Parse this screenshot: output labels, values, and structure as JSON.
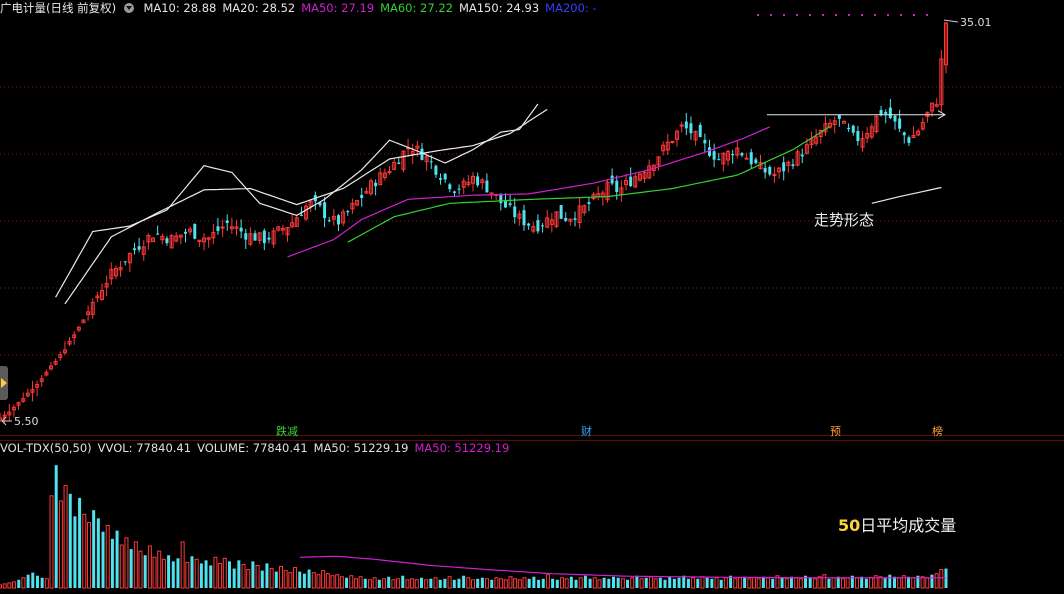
{
  "header": {
    "title": "广电计量(日线 前复权)",
    "indicators": [
      {
        "label": "MA10: 28.88",
        "color": "#e6e6e6"
      },
      {
        "label": "MA20: 28.52",
        "color": "#e6e6e6"
      },
      {
        "label": "MA50: 27.19",
        "color": "#d01fd0"
      },
      {
        "label": "MA60: 27.22",
        "color": "#35d035"
      },
      {
        "label": "MA150: 24.93",
        "color": "#e6e6e6"
      },
      {
        "label": "MA200: -",
        "color": "#3b3bff"
      }
    ]
  },
  "price_panel": {
    "high_label": "35.01",
    "low_label": "5.50",
    "annotation": "走势形态"
  },
  "event_tags": [
    {
      "label": "跌减",
      "color": "#3ad23a"
    },
    {
      "label": "财",
      "color": "#30a8ff"
    },
    {
      "label": "预",
      "color": "#ffa040"
    },
    {
      "label": "榜",
      "color": "#ffa040"
    }
  ],
  "volume_header": {
    "items": [
      {
        "label": "VOL-TDX(50,50)",
        "color": "#e0e0e0"
      },
      {
        "label": "VVOL: 77840.41",
        "color": "#e0e0e0"
      },
      {
        "label": "VOLUME: 77840.41",
        "color": "#e0e0e0"
      },
      {
        "label": "MA50: 51229.19",
        "color": "#e0e0e0"
      },
      {
        "label": "MA50: 51229.19",
        "color": "#d01fd0"
      }
    ]
  },
  "volume_annotation": {
    "number": "50",
    "text": "日平均成交量"
  },
  "colors": {
    "up": "#ff3838",
    "down": "#4fe3ef",
    "ma_short": "#eaeaea",
    "ma50": "#d01fd0",
    "ma60": "#35d035",
    "volume_ma": "#d01fd0"
  },
  "chart_data": {
    "type": "candlestick",
    "title": "广电计量(日线 前复权)",
    "y_label_high": 35.01,
    "y_label_low": 5.5,
    "close_path": [
      5.5,
      6.0,
      6.6,
      7.3,
      8.0,
      8.8,
      9.6,
      10.5,
      11.5,
      12.6,
      13.8,
      15.0,
      16.0,
      16.8,
      17.5,
      18.2,
      18.8,
      19.3,
      19.0,
      18.8,
      19.2,
      19.4,
      19.0,
      18.9,
      19.5,
      20.0,
      19.6,
      19.2,
      19.0,
      18.8,
      19.1,
      19.6,
      20.0,
      20.8,
      21.5,
      21.2,
      20.5,
      20.0,
      20.6,
      21.4,
      22.2,
      23.0,
      23.6,
      24.2,
      25.0,
      25.8,
      25.4,
      24.8,
      24.0,
      23.2,
      22.6,
      22.8,
      23.4,
      23.0,
      22.4,
      21.6,
      21.0,
      20.4,
      20.0,
      19.8,
      20.2,
      20.8,
      20.4,
      20.6,
      21.0,
      21.6,
      22.2,
      22.8,
      22.4,
      23.0,
      23.6,
      24.2,
      24.8,
      25.6,
      26.4,
      27.2,
      26.8,
      26.0,
      25.4,
      24.8,
      25.2,
      25.6,
      25.0,
      24.4,
      23.9,
      23.6,
      24.0,
      24.6,
      25.2,
      25.8,
      26.6,
      27.2,
      27.8,
      27.0,
      26.2,
      26.6,
      27.6,
      28.4,
      27.8,
      26.8,
      26.2,
      27.0,
      28.2,
      29.2,
      35.0
    ],
    "ma_series": [
      {
        "name": "MA10",
        "color": "#eaeaea",
        "start": 12,
        "anchors": [
          [
            0,
            14.5
          ],
          [
            8,
            19.4
          ],
          [
            16,
            19.8
          ],
          [
            24,
            21.0
          ],
          [
            32,
            24.3
          ],
          [
            38,
            23.8
          ],
          [
            44,
            21.5
          ],
          [
            52,
            20.6
          ],
          [
            58,
            21.8
          ],
          [
            66,
            24.0
          ],
          [
            72,
            26.2
          ],
          [
            78,
            25.4
          ],
          [
            84,
            24.5
          ],
          [
            90,
            25.5
          ],
          [
            96,
            26.8
          ],
          [
            100,
            27.0
          ],
          [
            104,
            28.9
          ]
        ]
      },
      {
        "name": "MA20",
        "color": "#eaeaea",
        "start": 14,
        "anchors": [
          [
            0,
            14.0
          ],
          [
            10,
            19.0
          ],
          [
            20,
            20.8
          ],
          [
            30,
            22.5
          ],
          [
            40,
            22.6
          ],
          [
            50,
            21.4
          ],
          [
            60,
            22.6
          ],
          [
            70,
            24.8
          ],
          [
            80,
            25.4
          ],
          [
            88,
            25.8
          ],
          [
            96,
            26.7
          ],
          [
            104,
            28.5
          ]
        ]
      },
      {
        "name": "MA50",
        "color": "#d01fd0",
        "start": 62,
        "anchors": [
          [
            0,
            17.5
          ],
          [
            10,
            18.8
          ],
          [
            16,
            20.3
          ],
          [
            26,
            21.8
          ],
          [
            40,
            22.1
          ],
          [
            52,
            22.2
          ],
          [
            66,
            23.0
          ],
          [
            78,
            24.0
          ],
          [
            90,
            25.3
          ],
          [
            98,
            26.3
          ],
          [
            104,
            27.19
          ]
        ]
      },
      {
        "name": "MA60",
        "color": "#35d035",
        "start": 75,
        "anchors": [
          [
            0,
            18.6
          ],
          [
            10,
            20.5
          ],
          [
            22,
            21.5
          ],
          [
            40,
            21.8
          ],
          [
            56,
            22.0
          ],
          [
            70,
            22.6
          ],
          [
            84,
            23.6
          ],
          [
            96,
            25.5
          ],
          [
            104,
            27.22
          ]
        ]
      },
      {
        "name": "MA150",
        "color": "#eaeaea",
        "start": 188,
        "anchors": [
          [
            0,
            21.5
          ],
          [
            6,
            22.0
          ],
          [
            14,
            22.6
          ],
          [
            24,
            23.4
          ],
          [
            36,
            24.3
          ],
          [
            44,
            24.93
          ]
        ]
      }
    ],
    "volume": {
      "values": [
        0.3,
        0.4,
        0.5,
        0.6,
        0.8,
        1.0,
        1.3,
        1.5,
        1.2,
        1.0,
        0.9,
        9.0,
        12.0,
        8.5,
        10.0,
        9.2,
        7.0,
        8.8,
        7.2,
        6.4,
        7.6,
        6.8,
        5.5,
        6.1,
        4.8,
        5.6,
        4.2,
        4.9,
        3.8,
        4.5,
        3.6,
        3.2,
        4.1,
        3.0,
        3.6,
        2.8,
        3.2,
        2.6,
        2.9,
        4.5,
        2.5,
        3.1,
        2.8,
        2.4,
        2.7,
        2.2,
        3.0,
        2.4,
        2.9,
        2.6,
        1.9,
        2.7,
        2.3,
        1.8,
        2.6,
        2.2,
        1.7,
        2.4,
        1.9,
        1.6,
        2.1,
        1.7,
        1.5,
        2.0,
        1.6,
        1.4,
        1.8,
        1.5,
        1.3,
        1.7,
        1.4,
        1.2,
        1.3,
        1.1,
        1.0,
        1.2,
        0.9,
        1.1,
        0.9,
        0.8,
        1.0,
        0.8,
        0.9,
        1.1,
        0.8,
        0.9,
        1.2,
        0.8,
        0.9,
        0.8,
        1.0,
        0.8,
        0.9,
        1.0,
        0.8,
        0.9,
        1.1,
        0.8,
        0.9,
        1.2,
        1.0,
        0.8,
        0.9,
        1.0,
        0.9,
        0.8,
        1.0,
        0.9,
        0.8,
        1.1,
        0.9,
        0.8,
        1.0,
        0.9,
        1.1,
        0.8,
        0.9,
        1.3,
        0.9,
        0.8,
        1.0,
        0.9,
        1.1,
        0.8,
        1.0,
        1.2,
        0.9,
        1.0,
        0.8,
        1.0,
        0.9,
        1.1,
        1.0,
        0.9,
        0.8,
        1.0,
        1.2,
        0.9,
        1.0,
        1.1,
        0.9,
        1.0,
        0.8,
        1.1,
        0.9,
        1.0,
        1.2,
        0.9,
        1.0,
        0.9,
        1.1,
        1.0,
        0.9,
        1.0,
        0.8,
        1.0,
        1.2,
        0.9,
        1.0,
        1.1,
        0.9,
        1.0,
        0.9,
        1.1,
        1.0,
        0.9,
        1.2,
        1.0,
        0.9,
        1.1,
        1.0,
        0.9,
        1.2,
        1.0,
        0.9,
        1.1,
        1.3,
        0.9,
        1.0,
        1.1,
        0.9,
        1.0,
        1.2,
        1.0,
        1.1,
        0.9,
        1.0,
        1.2,
        1.1,
        1.0,
        1.3,
        1.1,
        1.0,
        1.2,
        1.1,
        1.0,
        1.2,
        1.1,
        1.0,
        1.3,
        1.4,
        1.8,
        1.9
      ],
      "ma50_anchors": [
        [
          0,
          3.0
        ],
        [
          8,
          3.1
        ],
        [
          16,
          2.8
        ],
        [
          28,
          2.2
        ],
        [
          40,
          1.8
        ],
        [
          54,
          1.4
        ],
        [
          70,
          1.15
        ],
        [
          90,
          1.05
        ],
        [
          110,
          1.0
        ],
        [
          140,
          1.0
        ],
        [
          170,
          1.0
        ],
        [
          204,
          1.02
        ]
      ],
      "ma50_start": 64
    }
  }
}
